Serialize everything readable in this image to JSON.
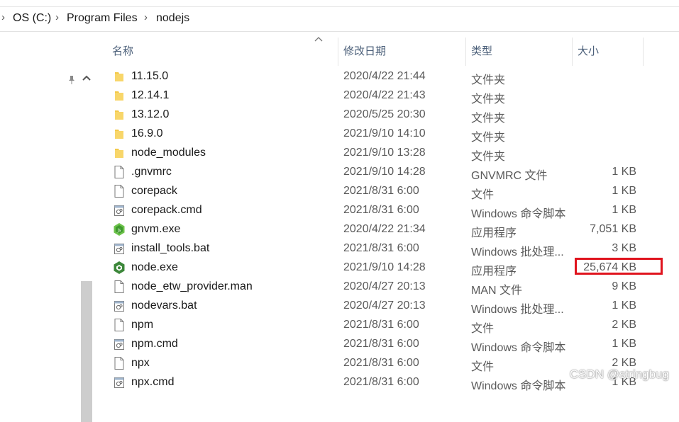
{
  "breadcrumb": {
    "items": [
      {
        "label": "OS (C:)"
      },
      {
        "label": "Program Files"
      },
      {
        "label": "nodejs"
      }
    ]
  },
  "columns": {
    "name": "名称",
    "date": "修改日期",
    "type": "类型",
    "size": "大小"
  },
  "files": [
    {
      "icon": "folder-icon",
      "name": "11.15.0",
      "date": "2020/4/22 21:44",
      "type": "文件夹",
      "size": ""
    },
    {
      "icon": "folder-icon",
      "name": "12.14.1",
      "date": "2020/4/22 21:43",
      "type": "文件夹",
      "size": ""
    },
    {
      "icon": "folder-icon",
      "name": "13.12.0",
      "date": "2020/5/25 20:30",
      "type": "文件夹",
      "size": ""
    },
    {
      "icon": "folder-icon",
      "name": "16.9.0",
      "date": "2021/9/10 14:10",
      "type": "文件夹",
      "size": ""
    },
    {
      "icon": "folder-icon",
      "name": "node_modules",
      "date": "2021/9/10 13:28",
      "type": "文件夹",
      "size": ""
    },
    {
      "icon": "file-icon",
      "name": ".gnvmrc",
      "date": "2021/9/10 14:28",
      "type": "GNVMRC 文件",
      "size": "1 KB"
    },
    {
      "icon": "file-icon",
      "name": "corepack",
      "date": "2021/8/31 6:00",
      "type": "文件",
      "size": "1 KB"
    },
    {
      "icon": "script-file-icon",
      "name": "corepack.cmd",
      "date": "2021/8/31 6:00",
      "type": "Windows 命令脚本",
      "size": "1 KB"
    },
    {
      "icon": "gnvm-exe-icon",
      "name": "gnvm.exe",
      "date": "2020/4/22 21:34",
      "type": "应用程序",
      "size": "7,051 KB"
    },
    {
      "icon": "script-file-icon",
      "name": "install_tools.bat",
      "date": "2021/8/31 6:00",
      "type": "Windows 批处理...",
      "size": "3 KB"
    },
    {
      "icon": "node-exe-icon",
      "name": "node.exe",
      "date": "2021/9/10 14:28",
      "type": "应用程序",
      "size": "25,674 KB"
    },
    {
      "icon": "file-icon",
      "name": "node_etw_provider.man",
      "date": "2020/4/27 20:13",
      "type": "MAN 文件",
      "size": "9 KB"
    },
    {
      "icon": "script-file-icon",
      "name": "nodevars.bat",
      "date": "2020/4/27 20:13",
      "type": "Windows 批处理...",
      "size": "1 KB"
    },
    {
      "icon": "file-icon",
      "name": "npm",
      "date": "2021/8/31 6:00",
      "type": "文件",
      "size": "2 KB"
    },
    {
      "icon": "script-file-icon",
      "name": "npm.cmd",
      "date": "2021/8/31 6:00",
      "type": "Windows 命令脚本",
      "size": "1 KB"
    },
    {
      "icon": "file-icon",
      "name": "npx",
      "date": "2021/8/31 6:00",
      "type": "文件",
      "size": "2 KB"
    },
    {
      "icon": "script-file-icon",
      "name": "npx.cmd",
      "date": "2021/8/31 6:00",
      "type": "Windows 命令脚本",
      "size": "1 KB"
    }
  ],
  "watermark": "CSDN @stringbug",
  "colors": {
    "folder": "#f3c94a",
    "highlight": "#e0141e",
    "header_text": "#4c607a",
    "node_green": "#3c873a"
  }
}
